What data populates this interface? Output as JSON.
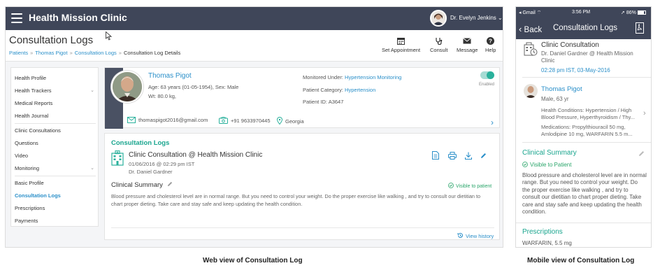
{
  "web": {
    "brand": "Health Mission Clinic",
    "user_name": "Dr. Evelyn Jenkins",
    "page_title": "Consultation Logs",
    "breadcrumb": [
      "Patients",
      "Thomas Pigot",
      "Consultation Logs",
      "Consultation Log Details"
    ],
    "actions": [
      "Set Appointment",
      "Consult",
      "Message",
      "Help"
    ],
    "sidebar": {
      "groups": [
        [
          "Health Profile",
          "Health Trackers",
          "Medical Reports",
          "Health Journal"
        ],
        [
          "Clinic Consultations",
          "Questions",
          "Video",
          "Monitoring"
        ],
        [
          "Basic Profile",
          "Consultation Logs",
          "Prescriptions",
          "Payments"
        ]
      ],
      "active": "Consultation Logs"
    },
    "patient": {
      "name": "Thomas Pigot",
      "age_sex": "Age: 63 years (01-05-1954), Sex: Male",
      "weight": "Wt: 80.0 kg,",
      "monitored_label": "Monitored Under:",
      "monitored_value": "Hypertension Monitoring",
      "category_label": "Patient Category:",
      "category_value": "Hypertension",
      "id_label": "Patient ID:",
      "id_value": "A3647",
      "email": "thomaspigot2016@gmail.com",
      "phone": "+91 9633970445",
      "location": "Georgia",
      "toggle_label": "Enabled"
    },
    "log": {
      "section_title": "Consultation Logs",
      "title": "Clinic Consultation @ Health Mission Clinic",
      "datetime": "01/06/2016 @ 02:29 pm IST",
      "doctor": "Dr. Daniel Gardner",
      "summary_heading": "Clinical Summary",
      "visibility": "Visible to patient",
      "summary_text": "Blood pressure and cholesterol level are in normal range. But you need to control your weight. Do the proper exercise like walking , and try to consult our dietitian to chart proper dieting. Take care and stay safe and keep updating the health condition.",
      "view_history": "View history"
    },
    "caption": "Web view of Consultation Log"
  },
  "mobile": {
    "carrier": "Gmail",
    "time": "3:56 PM",
    "battery": "86%",
    "back": "Back",
    "title": "Consultation Logs",
    "consult_title": "Clinic Consultation",
    "consult_doctor": "Dr. Daniel Gardner @ Health Mission Clinic",
    "consult_datetime": "02:28 pm IST, 03-May-2016",
    "patient_name": "Thomas Pigot",
    "patient_info": "Male, 63 yr",
    "conditions": "Health Conditions: Hypertension / High Blood Pressure, Hyperthyroidism / Thy...",
    "medications": "Medications: Propylthiouracil  50 mg, Amlodipine 10 mg, WARFARIN  5.5 m...",
    "summary_heading": "Clinical Summary",
    "visibility": "Visible to Patient",
    "summary_text": "Blood pressure and cholesterol level are in normal range. But you need to control your weight. Do the proper exercise like walking , and try to consult our dietitian to chart proper dieting. Take care and stay safe and keep updating the health condition.",
    "prescriptions_heading": "Prescriptions",
    "prescription_first": "WARFARIN,  5.5 mg",
    "caption": "Mobile view of Consultation Log"
  },
  "colors": {
    "header": "#3f4659",
    "link": "#2a8fc9",
    "accent_green": "#19a58e",
    "visible_green": "#2aa56a"
  }
}
